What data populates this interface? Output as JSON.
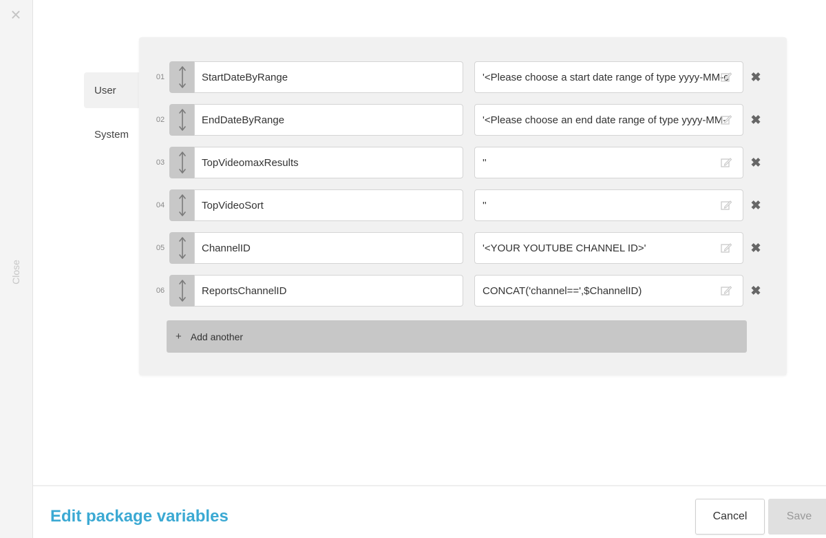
{
  "close_rail": {
    "close_label": "Close"
  },
  "tabs": [
    {
      "label": "User",
      "active": true
    },
    {
      "label": "System",
      "active": false
    }
  ],
  "variables": [
    {
      "num": "01",
      "name": "StartDateByRange",
      "value": "'<Please choose a start date range of type yyyy-MM-c"
    },
    {
      "num": "02",
      "name": "EndDateByRange",
      "value": "'<Please choose an end date range of type yyyy-MM-"
    },
    {
      "num": "03",
      "name": "TopVideomaxResults",
      "value": "''"
    },
    {
      "num": "04",
      "name": "TopVideoSort",
      "value": "''"
    },
    {
      "num": "05",
      "name": "ChannelID",
      "value": "'<YOUR YOUTUBE CHANNEL ID>'"
    },
    {
      "num": "06",
      "name": "ReportsChannelID",
      "value": "CONCAT('channel==',$ChannelID)"
    }
  ],
  "add_another_label": "Add another",
  "footer": {
    "title": "Edit package variables",
    "cancel_label": "Cancel",
    "save_label": "Save"
  },
  "colors": {
    "accent": "#3ba9d3",
    "panel_bg": "#f1f1f1",
    "handle_bg": "#c8c8c8"
  }
}
